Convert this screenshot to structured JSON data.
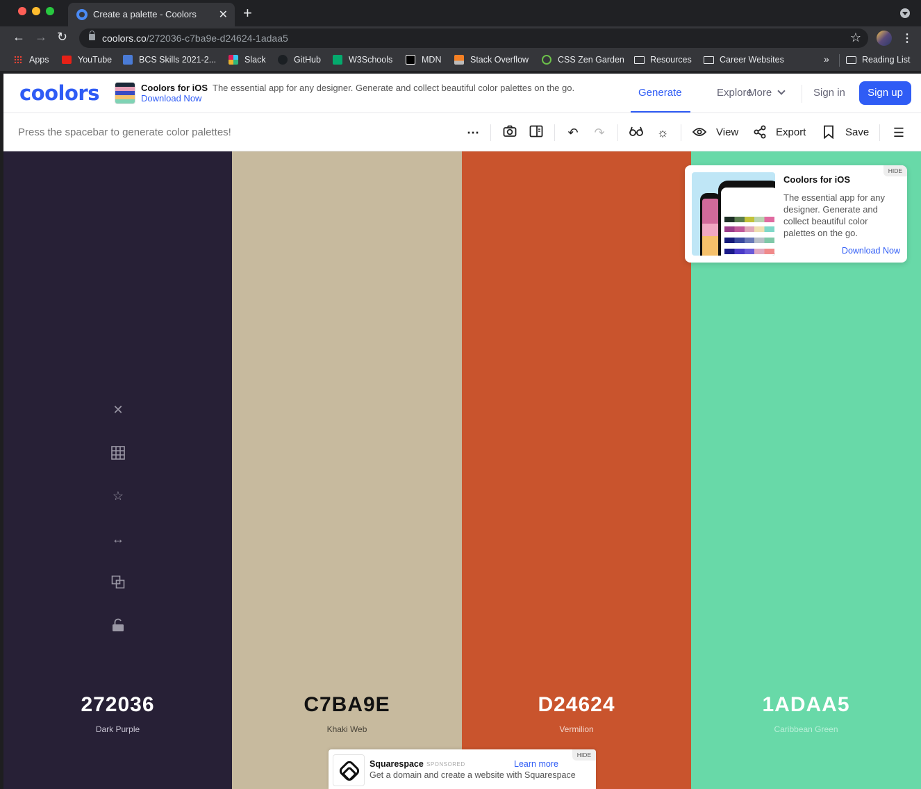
{
  "browser": {
    "tab_title": "Create a palette - Coolors",
    "url_host": "coolors.co",
    "url_path": "/272036-c7ba9e-d24624-1adaa5",
    "bookmarks": [
      {
        "label": "Apps",
        "icon": "apps-grid-icon"
      },
      {
        "label": "YouTube",
        "icon": "youtube-icon"
      },
      {
        "label": "BCS Skills 2021-2...",
        "icon": "bcs-icon"
      },
      {
        "label": "Slack",
        "icon": "slack-icon"
      },
      {
        "label": "GitHub",
        "icon": "github-icon"
      },
      {
        "label": "W3Schools",
        "icon": "w3schools-icon"
      },
      {
        "label": "MDN",
        "icon": "mdn-icon"
      },
      {
        "label": "Stack Overflow",
        "icon": "stackoverflow-icon"
      },
      {
        "label": "CSS Zen Garden",
        "icon": "zen-garden-icon"
      },
      {
        "label": "Resources",
        "icon": "folder-icon"
      },
      {
        "label": "Career Websites",
        "icon": "folder-icon"
      }
    ],
    "more_label": "»",
    "reading_list": "Reading List"
  },
  "header": {
    "logo": "coolors",
    "promo_title": "Coolors for iOS",
    "promo_desc": "The essential app for any designer. Generate and collect beautiful color palettes on the go.",
    "promo_link": "Download Now",
    "nav": {
      "generate": "Generate",
      "explore": "Explore",
      "more": "More"
    },
    "signin": "Sign in",
    "signup": "Sign up",
    "accent": "#2f5cf5"
  },
  "toolbar": {
    "hint": "Press the spacebar to generate color palettes!",
    "view": "View",
    "export": "Export",
    "save": "Save"
  },
  "palette": {
    "colors": [
      {
        "hex": "272036",
        "name": "Dark Purple",
        "bg": "#272036",
        "fg": "#ffffff",
        "sub": "#c7c3d2"
      },
      {
        "hex": "C7BA9E",
        "name": "Khaki Web",
        "bg": "#C7BA9E",
        "fg": "#111111",
        "sub": "#4a453a"
      },
      {
        "hex": "D24624",
        "name": "Vermilion",
        "bg": "#C9542D",
        "fg": "#ffffff",
        "sub": "#f3d6cc"
      },
      {
        "hex": "1ADAA5",
        "name": "Caribbean Green",
        "bg": "#68D9A8",
        "fg": "#ffffff",
        "sub": "#b9efd8"
      }
    ],
    "hover_tools": [
      "close-icon",
      "shades-grid-icon",
      "favorite-star-icon",
      "drag-arrows-icon",
      "copy-icon",
      "unlock-icon"
    ]
  },
  "ios_ad": {
    "hide": "HIDE",
    "title": "Coolors for iOS",
    "desc": "The essential app for any designer. Generate and collect beautiful color palettes on the go.",
    "link": "Download Now"
  },
  "sponsor_ad": {
    "hide": "HIDE",
    "name": "Squarespace",
    "sponsored": "SPONSORED",
    "learn_more": "Learn more",
    "desc": "Get a domain and create a website with Squarespace"
  }
}
